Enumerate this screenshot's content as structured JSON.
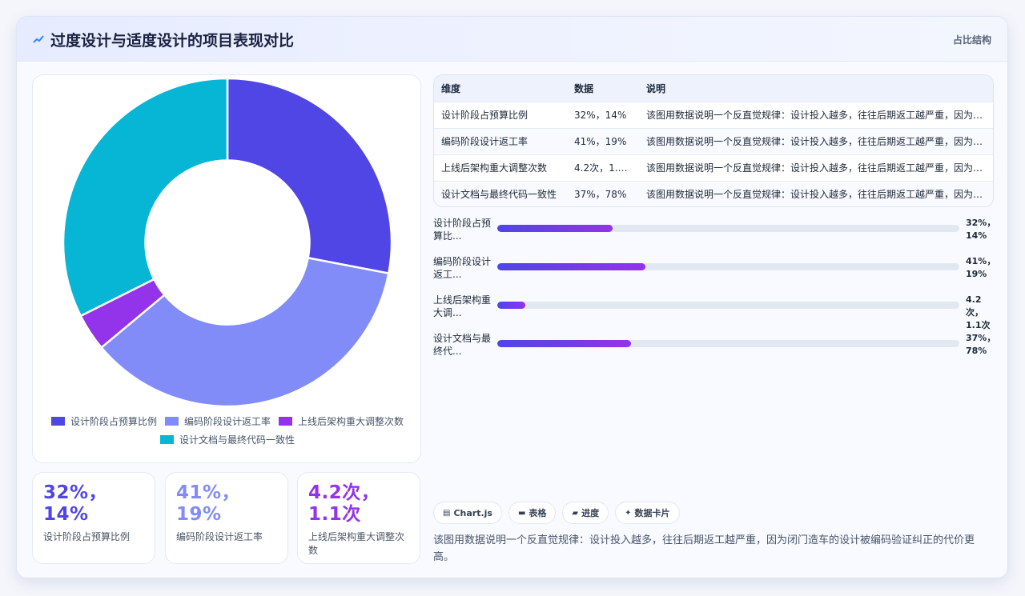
{
  "header": {
    "title": "过度设计与适度设计的项目表现对比",
    "tag": "占比结构"
  },
  "chart_data": {
    "type": "pie",
    "categories": [
      "设计阶段占预算比例",
      "编码阶段设计返工率",
      "上线后架构重大调整次数",
      "设计文档与最终代码一致性"
    ],
    "values": [
      32,
      41,
      4.2,
      37
    ],
    "colors": [
      "#4f46e5",
      "#818cf8",
      "#9333ea",
      "#06b6d4"
    ],
    "inner_radius_ratio": 0.5,
    "legend_position": "bottom"
  },
  "table": {
    "headers": [
      "维度",
      "数据",
      "说明"
    ],
    "rows": [
      [
        "设计阶段占预算比例",
        "32%，14%",
        "该图用数据说明一个反直觉规律：设计投入越多，往往后期返工越严重，因为闭门造车的设计被编码验证纠正的代价更高。"
      ],
      [
        "编码阶段设计返工率",
        "41%，19%",
        "该图用数据说明一个反直觉规律：设计投入越多，往往后期返工越严重，因为闭门造车的设计被编码验证纠正的代价更高。"
      ],
      [
        "上线后架构重大调整次数",
        "4.2次，1.1次",
        "该图用数据说明一个反直觉规律：设计投入越多，往往后期返工越严重，因为闭门造车的设计被编码验证纠正的代价更高。"
      ],
      [
        "设计文档与最终代码一致性",
        "37%，78%",
        "该图用数据说明一个反直觉规律：设计投入越多，往往后期返工越严重，因为闭门造车的设计被编码验证纠正的代价更高。"
      ]
    ]
  },
  "bars": [
    {
      "label": "设计阶段占预算比...",
      "value": "32%，14%",
      "fill": 0.25
    },
    {
      "label": "编码阶段设计返工...",
      "value": "41%，19%",
      "fill": 0.32
    },
    {
      "label": "上线后架构重大调...",
      "value": "4.2次，1.1次",
      "fill": 0.06
    },
    {
      "label": "设计文档与最终代...",
      "value": "37%，78%",
      "fill": 0.29
    }
  ],
  "stats": [
    {
      "value": "32%，14%",
      "label": "设计阶段占预算比例",
      "color": "#4f46e5"
    },
    {
      "value": "41%，19%",
      "label": "编码阶段设计返工率",
      "color": "#818cf8"
    },
    {
      "value": "4.2次，1.1次",
      "label": "上线后架构重大调整次数",
      "color": "#9333ea"
    }
  ],
  "chips": [
    {
      "icon": "chart-icon",
      "glyph": "▤",
      "label": "Chart.js"
    },
    {
      "icon": "table-icon",
      "glyph": "▬",
      "label": "表格"
    },
    {
      "icon": "progress-icon",
      "glyph": "▰",
      "label": "进度"
    },
    {
      "icon": "sparkle-icon",
      "glyph": "✦",
      "label": "数据卡片"
    }
  ],
  "description": "该图用数据说明一个反直觉规律：设计投入越多，往往后期返工越严重，因为闭门造车的设计被编码验证纠正的代价更高。"
}
